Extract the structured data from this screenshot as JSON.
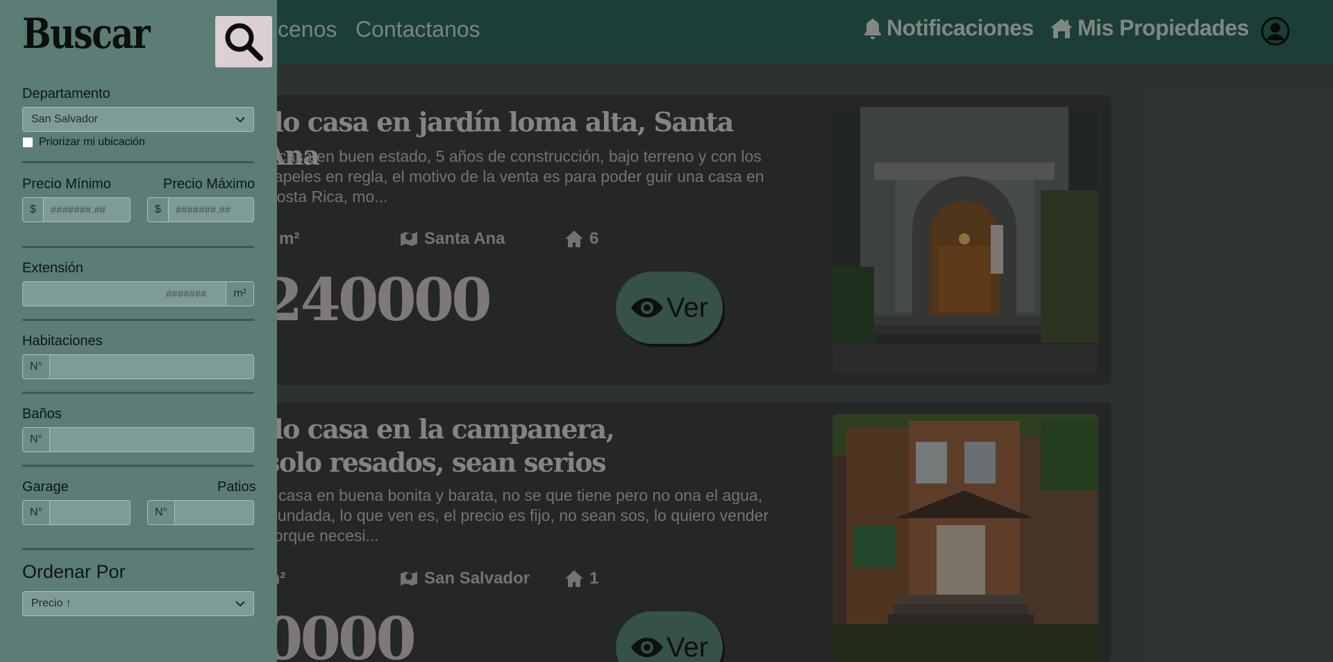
{
  "navbar": {
    "links": [
      "cenos",
      "Contactanos"
    ],
    "notifications_label": "Notificaciones",
    "my_properties_label": "Mis Propiedades",
    "colors": {
      "background": "#2f6b5f"
    }
  },
  "listings": [
    {
      "title": "do casa en jardín loma alta, Santa Ana",
      "description": "o casa en buen estado, 5 años de construcción, bajo terreno y con los papeles en regla, el motivo de la venta es para poder guir una casa en Costa Rica, mo...",
      "area": "0 m²",
      "location": "Santa Ana",
      "rooms": "6",
      "price": "240000",
      "view_label": "Ver"
    },
    {
      "title": "do casa en la campanera, solo resados, sean serios",
      "description": "o casa en buena bonita y barata, no se que tiene pero no ona el agua, inundada, lo que ven es, el precio es fijo, no sean sos, lo quiero vender porque necesi...",
      "area": "m²",
      "location": "San Salvador",
      "rooms": "1",
      "price": "0000",
      "view_label": "Ver"
    }
  ],
  "sidebar": {
    "title": "Buscar",
    "department": {
      "label": "Departamento",
      "selected": "San Salvador"
    },
    "prioritize_location_label": "Priorizar mi ubicación",
    "price_min": {
      "label": "Precio Mínimo",
      "prefix": "$",
      "placeholder": "#######.##"
    },
    "price_max": {
      "label": "Precio Máximo",
      "prefix": "$",
      "placeholder": "#######.##"
    },
    "extension": {
      "label": "Extensión",
      "placeholder": "#######",
      "suffix": "m²"
    },
    "rooms": {
      "label": "Habitaciones",
      "prefix": "N°"
    },
    "bathrooms": {
      "label": "Baños",
      "prefix": "N°"
    },
    "garage": {
      "label": "Garage",
      "prefix": "N°"
    },
    "patios": {
      "label": "Patios",
      "prefix": "N°"
    },
    "order_by": {
      "label": "Ordenar Por",
      "selected": "Precio ↑"
    },
    "colors": {
      "background": "#5c7c76",
      "search_button": "#dccfd2"
    }
  }
}
